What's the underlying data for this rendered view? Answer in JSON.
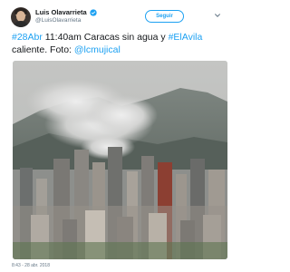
{
  "user": {
    "name": "Luis Olavarrieta",
    "handle": "@LuisOlavarrieta",
    "verified": true,
    "avatar_icon": "profile-photo"
  },
  "follow_button": {
    "label": "Seguir"
  },
  "menu_icon": "chevron-down-icon",
  "tweet": {
    "hashtag1": "#28Abr",
    "text1": " 11:40am Caracas sin agua y ",
    "hashtag2": "#ElAvila",
    "text2": " caliente. Foto: ",
    "mention": "@lcmujical"
  },
  "timestamp": "8:43 - 28 abr. 2018",
  "colors": {
    "link": "#1da1f2",
    "verified": "#1da1f2",
    "secondary_text": "#657786"
  }
}
